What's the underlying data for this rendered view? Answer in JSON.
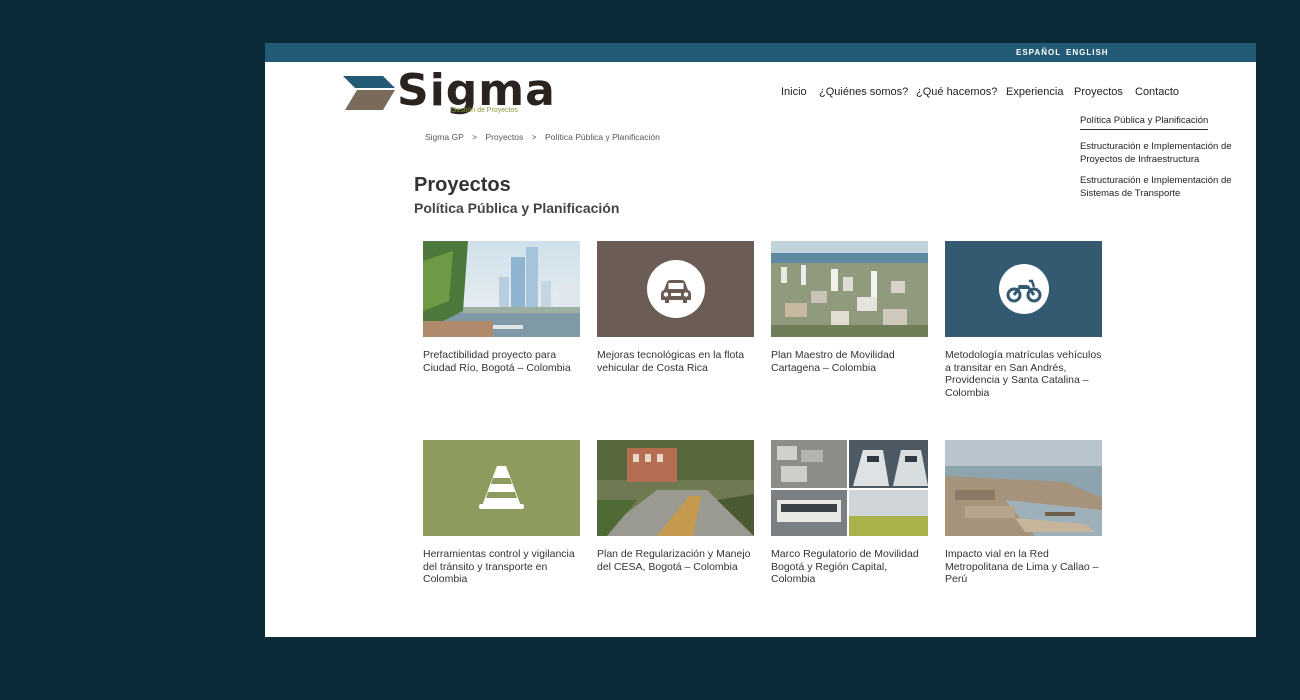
{
  "languages": {
    "es": "ESPAÑOL",
    "en": "ENGLISH"
  },
  "logo": {
    "name": "Sigma",
    "tagline": "Gestión de Proyectos"
  },
  "nav": [
    {
      "label": "Inicio"
    },
    {
      "label": "¿Quiénes somos?"
    },
    {
      "label": "¿Qué hacemos?"
    },
    {
      "label": "Experiencia"
    },
    {
      "label": "Proyectos"
    },
    {
      "label": "Contacto"
    }
  ],
  "dropdown": [
    {
      "label": "Política Pública y Planificación"
    },
    {
      "label": "Estructuración e Implementación de Proyectos de Infraestructura"
    },
    {
      "label": "Estructuración e Implementación de Sistemas de Transporte"
    }
  ],
  "breadcrumb": {
    "items": [
      "Sigma GP",
      "Proyectos",
      "Política Pública y Planificación"
    ],
    "separator": ">"
  },
  "page": {
    "title": "Proyectos",
    "subtitle": "Política Pública y Planificación"
  },
  "projects": [
    {
      "caption": "Prefactibilidad proyecto para Ciudad Río, Bogotá – Colombia",
      "image": "city-river-photo"
    },
    {
      "caption": "Mejoras tecnológicas en la flota vehicular de Costa Rica",
      "image": "car-icon",
      "bg": "#6b5d55"
    },
    {
      "caption": "Plan Maestro de Movilidad Cartagena – Colombia",
      "image": "cartagena-photo"
    },
    {
      "caption": "Metodología matrículas vehículos a transitar en San Andrés, Providencia y Santa Catalina – Colombia",
      "image": "motorcycle-icon",
      "bg": "#345a72"
    },
    {
      "caption": "Herramientas control y vigilancia del tránsito y transporte en Colombia",
      "image": "traffic-cone-icon",
      "bg": "#8e9b5e"
    },
    {
      "caption": "Plan de Regularización y Manejo del CESA, Bogotá – Colombia",
      "image": "campus-photo"
    },
    {
      "caption": "Marco Regulatorio de Movilidad Bogotá y Región Capital, Colombia",
      "image": "trains-collage-photo"
    },
    {
      "caption": "Impacto vial en la Red Metropolitana de Lima y Callao – Perú",
      "image": "port-aerial-photo"
    }
  ],
  "colors": {
    "background": "#0c2b38",
    "topbar": "#235a75",
    "logo_text": "#2a2320",
    "logo_accent": "#8a9b3a"
  }
}
